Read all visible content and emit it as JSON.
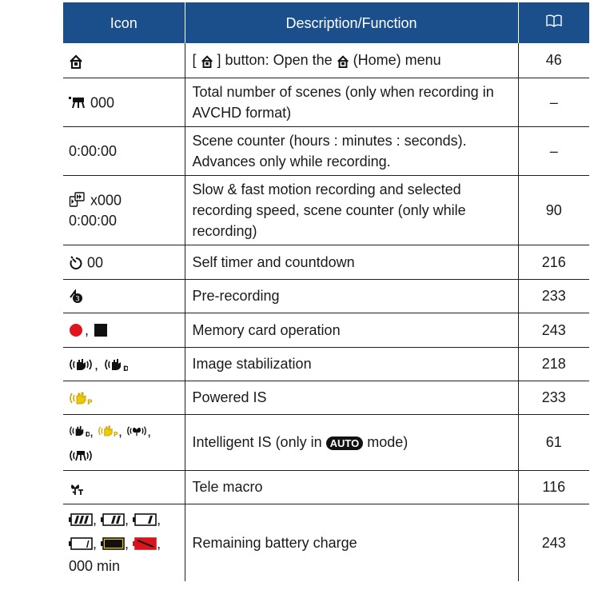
{
  "header": {
    "col_icon": "Icon",
    "col_description": "Description/Function",
    "col_page_icon": "book-icon"
  },
  "rows": [
    {
      "icon_text": "",
      "description": "[ ⌂ ] button: Open the ⌂ (Home) menu",
      "desc_a": "[ ",
      "desc_b": " ] button: Open the ",
      "desc_c": " (Home) menu",
      "page": "46"
    },
    {
      "icon_text": "000",
      "description": "Total number of scenes (only when recording in AVCHD format)",
      "page": "–"
    },
    {
      "icon_text": "0:00:00",
      "description": "Scene counter (hours : minutes : seconds). Advances only while recording.",
      "page": "–"
    },
    {
      "icon_text_1": "x000",
      "icon_text_2": "0:00:00",
      "description": "Slow & fast motion recording and selected recording speed, scene counter (only while recording)",
      "page": "90"
    },
    {
      "icon_text": "00",
      "description": "Self timer and countdown",
      "page": "216"
    },
    {
      "icon_text": "",
      "description": "Pre-recording",
      "page": "233"
    },
    {
      "icon_text": ",",
      "description": "Memory card operation",
      "page": "243"
    },
    {
      "icon_text": ",",
      "description": "Image stabilization",
      "page": "218"
    },
    {
      "icon_text": "",
      "description": "Powered IS",
      "page": "233"
    },
    {
      "icon_sep": ",",
      "description_a": "Intelligent IS (only in ",
      "description_b": "AUTO",
      "description_c": " mode)",
      "page": "61"
    },
    {
      "icon_text": "",
      "description": "Tele macro",
      "page": "116"
    },
    {
      "icon_sep": ",",
      "icon_tail": "000 min",
      "description": "Remaining battery charge",
      "page": "243"
    }
  ],
  "colors": {
    "header_bg": "#1b4f8c",
    "header_text": "#ffffff",
    "record_dot": "#e0141e",
    "powered_is_yellow": "#f0c800",
    "battery_low": "#f0c800",
    "battery_empty": "#d8141e"
  }
}
